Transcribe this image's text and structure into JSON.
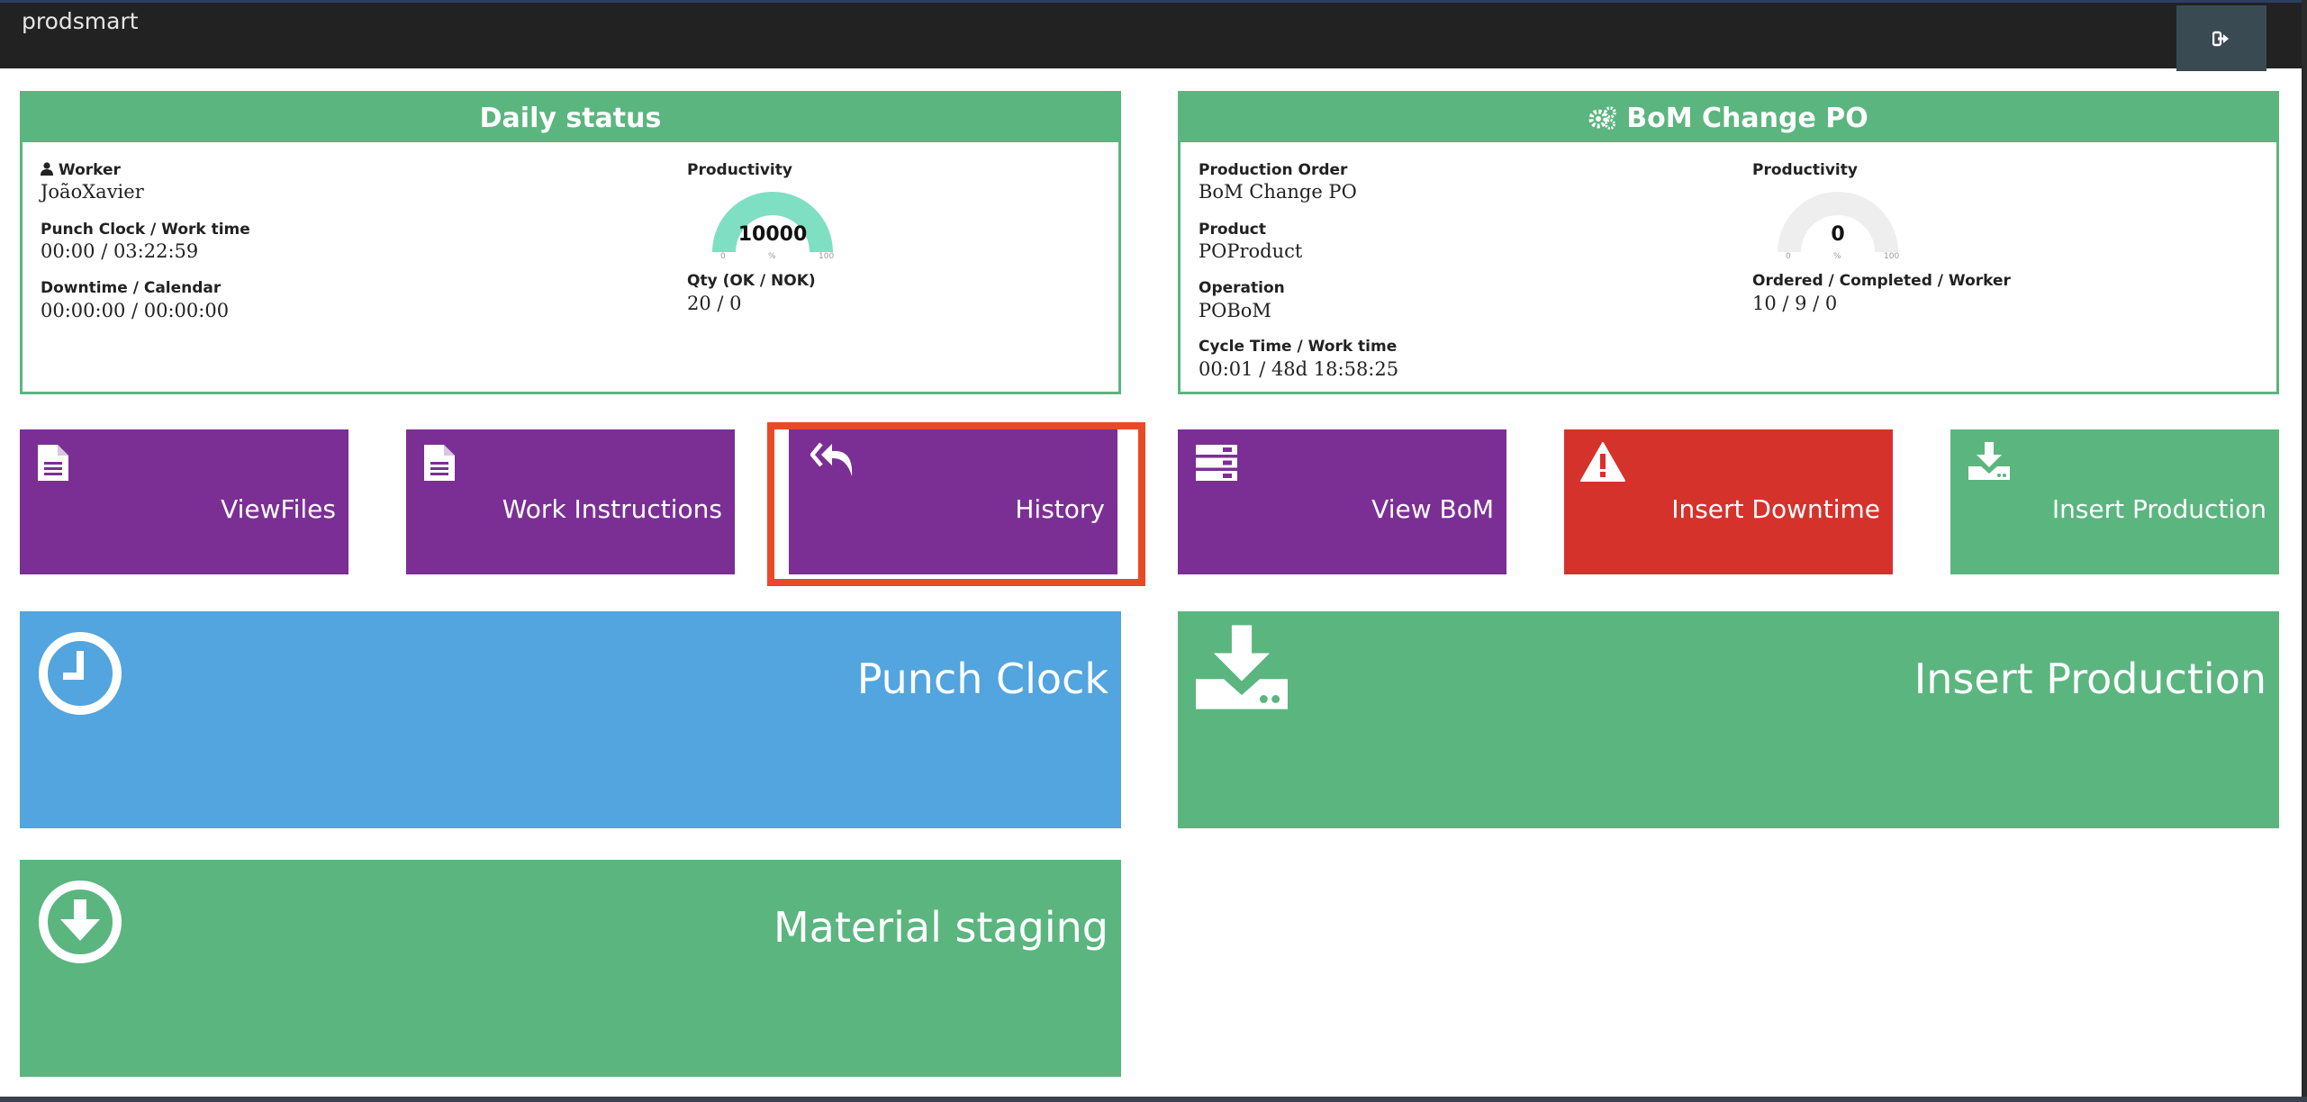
{
  "app": {
    "brand": "prodsmart",
    "logout_icon": "sign-out-icon"
  },
  "daily_status": {
    "title": "Daily status",
    "worker_label": "Worker",
    "worker_value": "JoãoXavier",
    "punch_label": "Punch Clock / Work time",
    "punch_value": "00:00 / 03:22:59",
    "downtime_label": "Downtime / Calendar",
    "downtime_value": "00:00:00 / 00:00:00",
    "productivity_label": "Productivity",
    "productivity_value": "10000",
    "gauge_min": "0",
    "gauge_unit": "%",
    "gauge_max": "100",
    "gauge_fill": 1.0,
    "gauge_color": "#7fdfc3",
    "qty_label": "Qty (OK / NOK)",
    "qty_value": "20 / 0"
  },
  "bom_panel": {
    "title": "BoM Change PO",
    "title_icon": "cogs-icon",
    "po_label": "Production Order",
    "po_value": "BoM Change PO",
    "product_label": "Product",
    "product_value": "POProduct",
    "operation_label": "Operation",
    "operation_value": "POBoM",
    "cycle_label": "Cycle Time / Work time",
    "cycle_value": "00:01 / 48d 18:58:25",
    "productivity_label": "Productivity",
    "productivity_value": "0",
    "gauge_min": "0",
    "gauge_unit": "%",
    "gauge_max": "100",
    "gauge_fill": 0.0,
    "ordered_label": "Ordered / Completed / Worker",
    "ordered_value": "10 / 9 / 0"
  },
  "tiles": {
    "view_files": {
      "label": "ViewFiles",
      "icon": "file-icon",
      "color": "#7b2f95"
    },
    "work_instructions": {
      "label": "Work Instructions",
      "icon": "file-icon",
      "color": "#7b2f95"
    },
    "history": {
      "label": "History",
      "icon": "reply-all-icon",
      "color": "#7b2f95",
      "highlight_color": "#e84a26"
    },
    "view_bom": {
      "label": "View BoM",
      "icon": "server-icon",
      "color": "#7b2f95"
    },
    "insert_downtime": {
      "label": "Insert Downtime",
      "icon": "warning-icon",
      "color": "#d5322b"
    },
    "insert_production_small": {
      "label": "Insert Production",
      "icon": "download-tray-icon",
      "color": "#5bb57f"
    },
    "punch_clock": {
      "label": "Punch Clock",
      "icon": "clock-icon",
      "color": "#52a5de"
    },
    "insert_production_big": {
      "label": "Insert Production",
      "icon": "download-tray-icon",
      "color": "#5bb57f"
    },
    "material_staging": {
      "label": "Material staging",
      "icon": "arrow-circle-down-icon",
      "color": "#5bb57f"
    }
  }
}
